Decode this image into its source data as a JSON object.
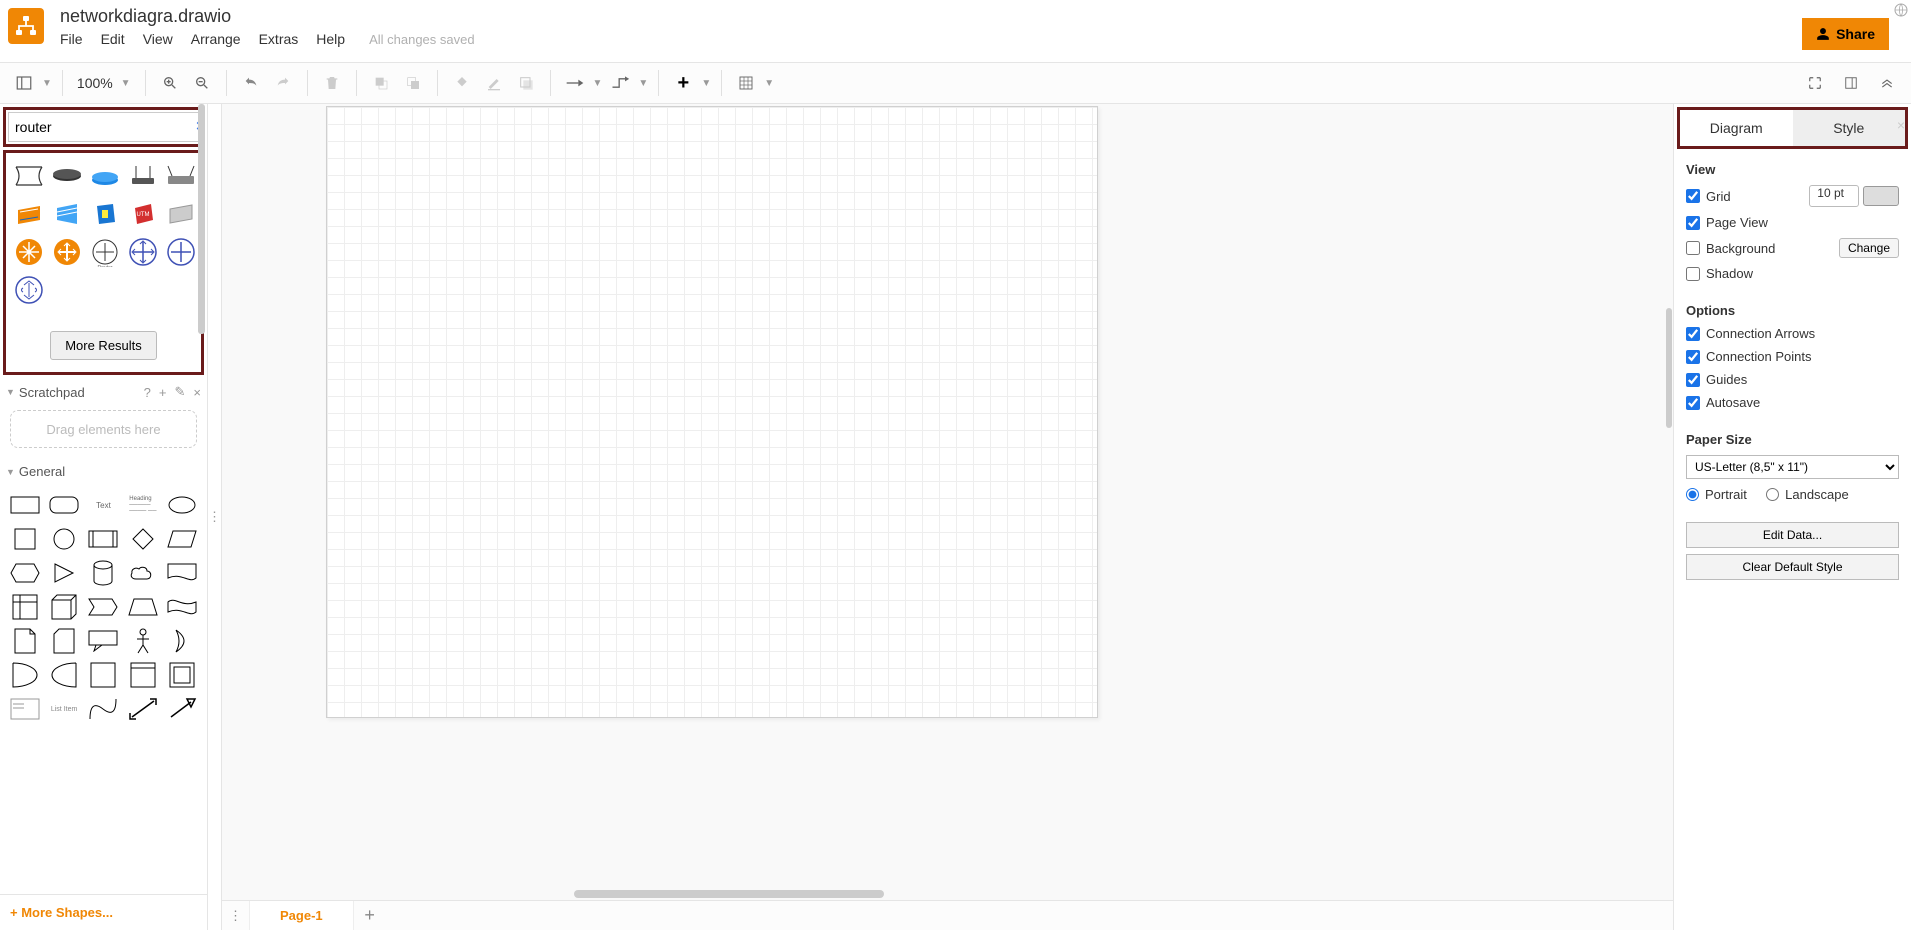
{
  "header": {
    "title": "networkdiagra.drawio",
    "menus": [
      "File",
      "Edit",
      "View",
      "Arrange",
      "Extras",
      "Help"
    ],
    "saved_status": "All changes saved",
    "share_label": "Share"
  },
  "toolbar": {
    "zoom": "100%"
  },
  "search": {
    "value": "router",
    "more_results": "More Results"
  },
  "scratchpad": {
    "title": "Scratchpad",
    "placeholder": "Drag elements here"
  },
  "general": {
    "title": "General"
  },
  "more_shapes": "+  More Shapes...",
  "tabs": {
    "page1": "Page-1"
  },
  "right_panel": {
    "tab_diagram": "Diagram",
    "tab_style": "Style",
    "view_title": "View",
    "grid": "Grid",
    "grid_size": "10 pt",
    "page_view": "Page View",
    "background": "Background",
    "change": "Change",
    "shadow": "Shadow",
    "options_title": "Options",
    "conn_arrows": "Connection Arrows",
    "conn_points": "Connection Points",
    "guides": "Guides",
    "autosave": "Autosave",
    "paper_title": "Paper Size",
    "paper_value": "US-Letter (8,5\" x 11\")",
    "portrait": "Portrait",
    "landscape": "Landscape",
    "edit_data": "Edit Data...",
    "clear_style": "Clear Default Style"
  }
}
